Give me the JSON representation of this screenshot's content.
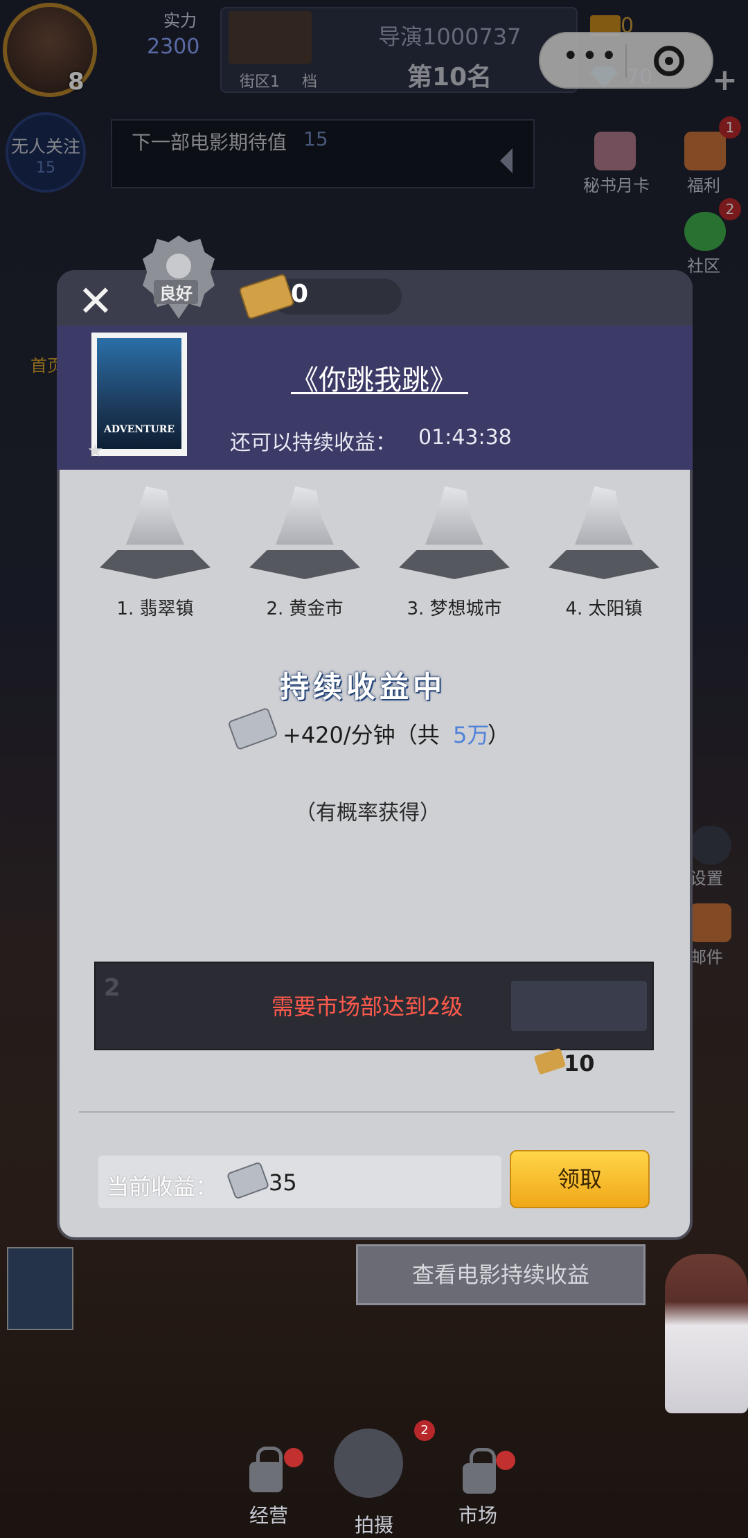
{
  "top": {
    "level": "8",
    "power_label": "实力",
    "power_value": "2300",
    "director": "导演1000737",
    "rank": "第10名",
    "district": "街区1",
    "district_suffix": "档",
    "gold": "0",
    "gems": "70",
    "capsule_menu": "•••"
  },
  "fans": {
    "label": "无人关注",
    "value": "15"
  },
  "anticipation": {
    "label": "下一部电影期待值",
    "value": "15"
  },
  "side": {
    "secretary": "秘书月卡",
    "welfare": "福利",
    "welfare_badge": "1",
    "community": "社区",
    "community_badge": "2",
    "settings": "设置",
    "mail": "邮件",
    "left_partial": "首页"
  },
  "modal": {
    "seal_text": "良好",
    "tickets": "0",
    "poster_text": "ADVENTURE",
    "title": "《你跳我跳》",
    "remaining_label": "还可以持续收益：",
    "remaining_time": "01:43:38",
    "cities": [
      {
        "label": "1. 翡翠镇"
      },
      {
        "label": "2. 黄金市"
      },
      {
        "label": "3. 梦想城市"
      },
      {
        "label": "4. 太阳镇"
      }
    ],
    "earning_title": "持续收益中",
    "rate_prefix": "+420/分钟（共",
    "rate_total": "5万",
    "rate_suffix": "）",
    "chance_note": "（有概率获得）",
    "locked_number": "2",
    "locked_text": "需要市场部达到2级",
    "unlock_cost": "10",
    "current_label": "当前收益：",
    "current_value": "35",
    "claim_button": "领取"
  },
  "view_earnings_button": "查看电影持续收益",
  "bottom_nav": {
    "business": "经营",
    "shoot": "拍摄",
    "shoot_badge": "2",
    "market": "市场"
  },
  "colors": {
    "accent_yellow": "#f0a818",
    "locked_red": "#ff5a4c",
    "header_purple": "#3c3a66",
    "link_blue": "#4e82d8"
  }
}
